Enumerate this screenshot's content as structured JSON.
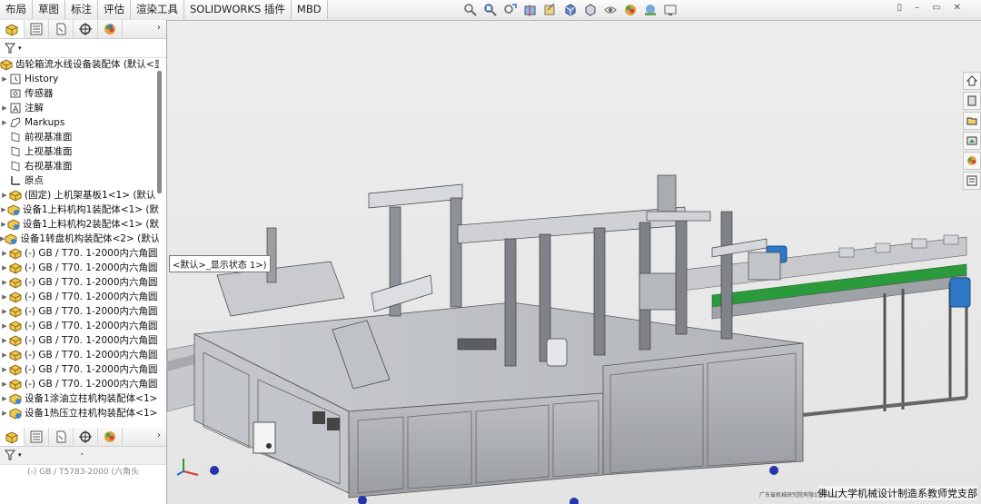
{
  "ribbon": {
    "tabs": [
      "布局",
      "草图",
      "标注",
      "评估",
      "渲染工具",
      "SOLIDWORKS 插件",
      "MBD"
    ]
  },
  "heads_up_icons": [
    "zoom-fit-icon",
    "zoom-area-icon",
    "previous-view-icon",
    "section-view-icon",
    "dynamic-annotation-icon",
    "view-orientation-icon",
    "display-style-icon",
    "hide-show-icon",
    "edit-appearance-icon",
    "apply-scene-icon",
    "view-settings-icon"
  ],
  "feature_tree": {
    "root": "齿轮箱流水线设备装配体 (默认<显",
    "items": [
      {
        "label": "History",
        "icon": "history-icon",
        "expandable": true
      },
      {
        "label": "传感器",
        "icon": "sensor-icon",
        "expandable": false
      },
      {
        "label": "注解",
        "icon": "annotation-icon",
        "expandable": true
      },
      {
        "label": "Markups",
        "icon": "markups-icon",
        "expandable": true
      },
      {
        "label": "前视基准面",
        "icon": "plane-icon",
        "expandable": false
      },
      {
        "label": "上视基准面",
        "icon": "plane-icon",
        "expandable": false
      },
      {
        "label": "右视基准面",
        "icon": "plane-icon",
        "expandable": false
      },
      {
        "label": "原点",
        "icon": "origin-icon",
        "expandable": false
      },
      {
        "label": "(固定) 上机架基板1<1> (默认",
        "icon": "part-icon",
        "expandable": true
      },
      {
        "label": "设备1上料机构1装配体<1> (默",
        "icon": "subassembly-icon",
        "expandable": true
      },
      {
        "label": "设备1上料机构2装配体<1> (默",
        "icon": "subassembly-icon",
        "expandable": true
      },
      {
        "label": "设备1转盘机构装配体<2> (默认",
        "icon": "subassembly-icon",
        "expandable": true
      },
      {
        "label": "(-) GB / T70.  1-2000内六角圆",
        "icon": "part-icon",
        "expandable": true
      },
      {
        "label": "(-) GB / T70.  1-2000内六角圆",
        "icon": "part-icon",
        "expandable": true
      },
      {
        "label": "(-) GB / T70.  1-2000内六角圆",
        "icon": "part-icon",
        "expandable": true
      },
      {
        "label": "(-) GB / T70.  1-2000内六角圆",
        "icon": "part-icon",
        "expandable": true
      },
      {
        "label": "(-) GB / T70.  1-2000内六角圆",
        "icon": "part-icon",
        "expandable": true
      },
      {
        "label": "(-) GB / T70.  1-2000内六角圆",
        "icon": "part-icon",
        "expandable": true
      },
      {
        "label": "(-) GB / T70.  1-2000内六角圆",
        "icon": "part-icon",
        "expandable": true
      },
      {
        "label": "(-) GB / T70.  1-2000内六角圆",
        "icon": "part-icon",
        "expandable": true
      },
      {
        "label": "(-) GB / T70.  1-2000内六角圆",
        "icon": "part-icon",
        "expandable": true
      },
      {
        "label": "(-) GB / T70.  1-2000内六角圆",
        "icon": "part-icon",
        "expandable": true
      },
      {
        "label": "设备1涂油立柱机构装配体<1>",
        "icon": "subassembly-icon",
        "expandable": true
      },
      {
        "label": "设备1热压立柱机构装配体<1>",
        "icon": "subassembly-icon",
        "expandable": true
      }
    ]
  },
  "lower_panel": {
    "partial_row": "(-) GB / T5783-2000 (六角头"
  },
  "viewport": {
    "tooltip": "<默认>_显示状态 1>)",
    "watermark": "佛山大学机械设计制造系教师党支部",
    "watermark_small": "广东省机械研究院有限公司制作"
  },
  "colors": {
    "accent_blue": "#1f6fd1",
    "frame_gray": "#b8babd",
    "cabinet_gray": "#a4a7ab",
    "conveyor_green": "#2a9a3a",
    "motor_blue": "#2f78c8"
  }
}
